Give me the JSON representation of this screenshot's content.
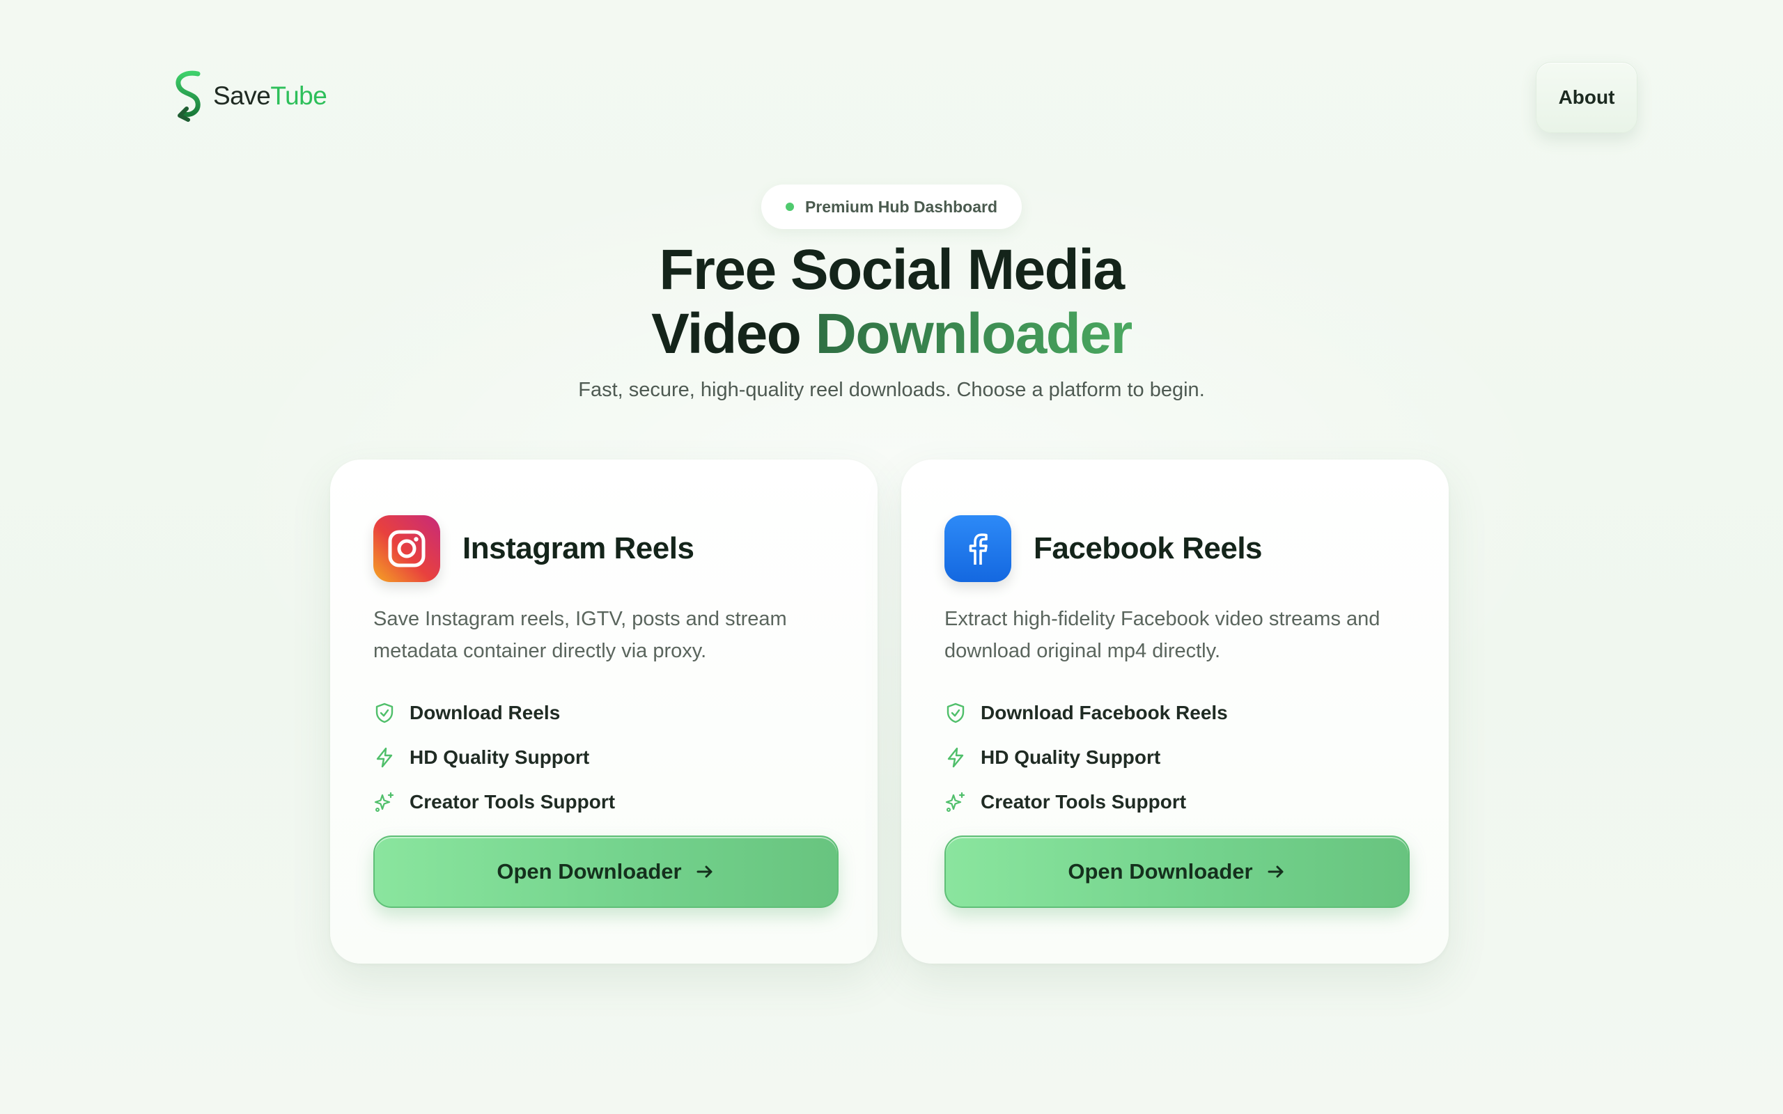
{
  "brand": {
    "name_part1": "Save",
    "name_part2": "Tube",
    "accent_color": "#2dbf5a"
  },
  "nav": {
    "about_label": "About"
  },
  "hero": {
    "badge": "Premium Hub Dashboard",
    "title_line1": "Free Social Media",
    "title_line2_plain": "Video ",
    "title_line2_accent": "Downloader",
    "subtitle": "Fast, secure, high-quality reel downloads. Choose a platform to begin."
  },
  "cards": [
    {
      "title": "Instagram Reels",
      "icon": "instagram-icon",
      "description": "Save Instagram reels, IGTV, posts and stream metadata container directly via proxy.",
      "features": [
        {
          "icon": "shield-check-icon",
          "label": "Download Reels"
        },
        {
          "icon": "lightning-icon",
          "label": "HD Quality Support"
        },
        {
          "icon": "sparkles-icon",
          "label": "Creator Tools Support"
        }
      ],
      "button_label": "Open Downloader"
    },
    {
      "title": "Facebook Reels",
      "icon": "facebook-icon",
      "description": "Extract high-fidelity Facebook video streams and download original mp4 directly.",
      "features": [
        {
          "icon": "shield-check-icon",
          "label": "Download Facebook Reels"
        },
        {
          "icon": "lightning-icon",
          "label": "HD Quality Support"
        },
        {
          "icon": "sparkles-icon",
          "label": "Creator Tools Support"
        }
      ],
      "button_label": "Open Downloader"
    }
  ]
}
